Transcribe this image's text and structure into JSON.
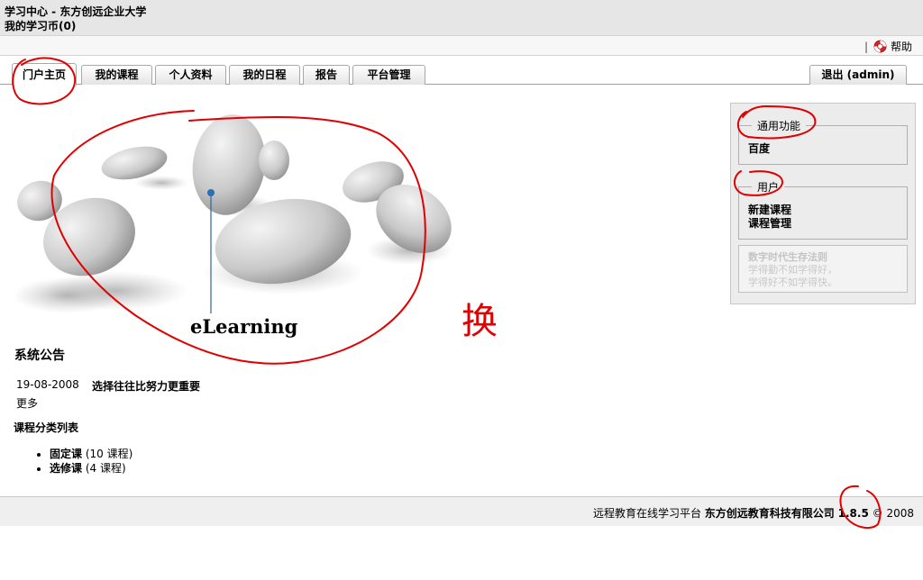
{
  "header": {
    "title": "学习中心 - 东方创远企业大学",
    "coins": "我的学习币(0)"
  },
  "help": {
    "separator": "|",
    "label": "帮助"
  },
  "tabs": [
    "门户主页",
    "我的课程",
    "个人资料",
    "我的日程",
    "报告",
    "平台管理"
  ],
  "logout": "退出 (admin)",
  "hero": {
    "caption": "eLearning"
  },
  "sidebar": {
    "general": {
      "title": "通用功能",
      "links": [
        "百度"
      ]
    },
    "user": {
      "title": "用户",
      "links": [
        "新建课程",
        "课程管理"
      ]
    },
    "quote": [
      "数字时代生存法则",
      "学得勤不如学得好，",
      "学得好不如学得快。"
    ]
  },
  "announcements": {
    "title": "系统公告",
    "items": [
      {
        "date": "19-08-2008",
        "text": "选择往往比努力更重要"
      }
    ],
    "more": "更多"
  },
  "categories": {
    "title": "课程分类列表",
    "items": [
      {
        "name": "固定课",
        "count": "(10 课程)"
      },
      {
        "name": "选修课",
        "count": "(4 课程)"
      }
    ]
  },
  "footer": {
    "platform": "远程教育在线学习平台",
    "company": "东方创远教育科技有限公司",
    "version": "1.8.5",
    "copyright": "© 2008"
  },
  "annotation_text": "换"
}
